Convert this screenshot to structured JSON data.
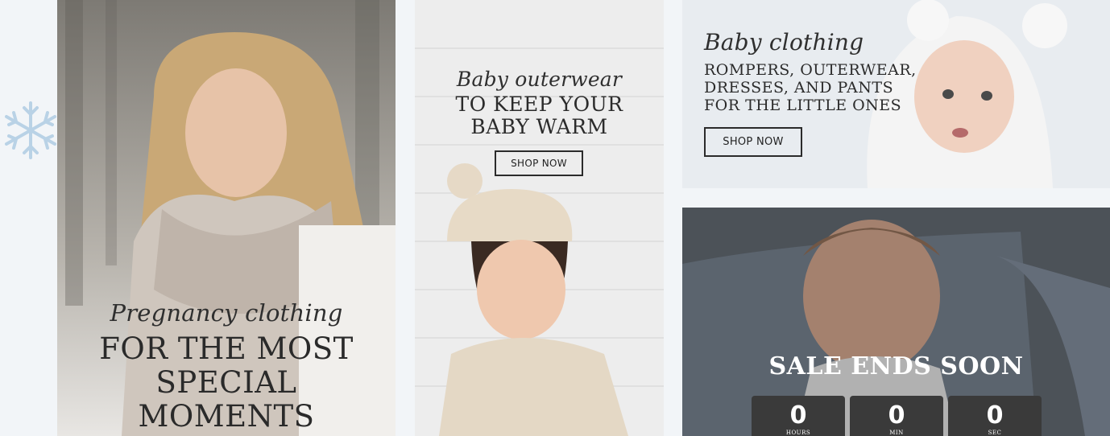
{
  "pregnancy": {
    "script_title": "Pregnancy clothing",
    "lines": [
      "FOR THE MOST",
      "SPECIAL",
      "MOMENTS"
    ]
  },
  "outerwear": {
    "script_title": "Baby outerwear",
    "lines": [
      "TO KEEP YOUR",
      "BABY WARM"
    ],
    "button": "SHOP NOW"
  },
  "clothing": {
    "script_title": "Baby clothing",
    "lines": [
      "ROMPERS, OUTERWEAR,",
      "DRESSES, AND PANTS",
      "FOR THE LITTLE ONES"
    ],
    "button": "SHOP NOW"
  },
  "sale": {
    "title": "SALE ENDS SOON",
    "countdown": [
      {
        "value": "0",
        "unit": "HOURS"
      },
      {
        "value": "0",
        "unit": "MIN"
      },
      {
        "value": "0",
        "unit": "SEC"
      }
    ]
  },
  "icons": [
    "snowflake-icon"
  ],
  "colors": {
    "page_bg": "#f2f5f8",
    "text_dark": "#2b2b2b",
    "countdown_bg": "#3a3a3a",
    "snowflake": "#b9d2e6"
  }
}
